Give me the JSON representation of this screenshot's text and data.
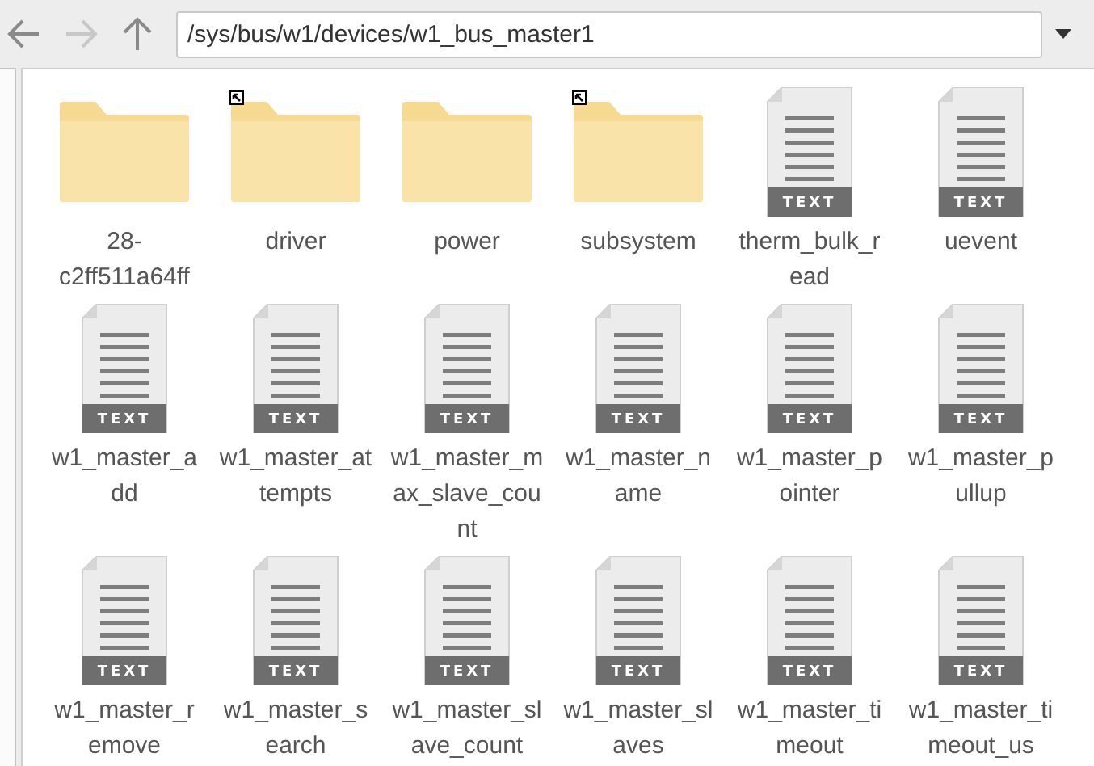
{
  "toolbar": {
    "back": {
      "disabled": false
    },
    "forward": {
      "disabled": true
    },
    "path": "/sys/bus/w1/devices/w1_bus_master1"
  },
  "items": [
    {
      "kind": "folder",
      "name": "28-c2ff511a64ff",
      "symlink": false
    },
    {
      "kind": "folder",
      "name": "driver",
      "symlink": true
    },
    {
      "kind": "folder",
      "name": "power",
      "symlink": false
    },
    {
      "kind": "folder",
      "name": "subsystem",
      "symlink": true
    },
    {
      "kind": "text",
      "name": "therm_bulk_read",
      "badge": "TEXT"
    },
    {
      "kind": "text",
      "name": "uevent",
      "badge": "TEXT"
    },
    {
      "kind": "text",
      "name": "w1_master_add",
      "badge": "TEXT"
    },
    {
      "kind": "text",
      "name": "w1_master_attempts",
      "badge": "TEXT"
    },
    {
      "kind": "text",
      "name": "w1_master_max_slave_count",
      "badge": "TEXT"
    },
    {
      "kind": "text",
      "name": "w1_master_name",
      "badge": "TEXT"
    },
    {
      "kind": "text",
      "name": "w1_master_pointer",
      "badge": "TEXT"
    },
    {
      "kind": "text",
      "name": "w1_master_pullup",
      "badge": "TEXT"
    },
    {
      "kind": "text",
      "name": "w1_master_remove",
      "badge": "TEXT"
    },
    {
      "kind": "text",
      "name": "w1_master_search",
      "badge": "TEXT"
    },
    {
      "kind": "text",
      "name": "w1_master_slave_count",
      "badge": "TEXT"
    },
    {
      "kind": "text",
      "name": "w1_master_slaves",
      "badge": "TEXT"
    },
    {
      "kind": "text",
      "name": "w1_master_timeout",
      "badge": "TEXT"
    },
    {
      "kind": "text",
      "name": "w1_master_timeout_us",
      "badge": "TEXT"
    }
  ]
}
